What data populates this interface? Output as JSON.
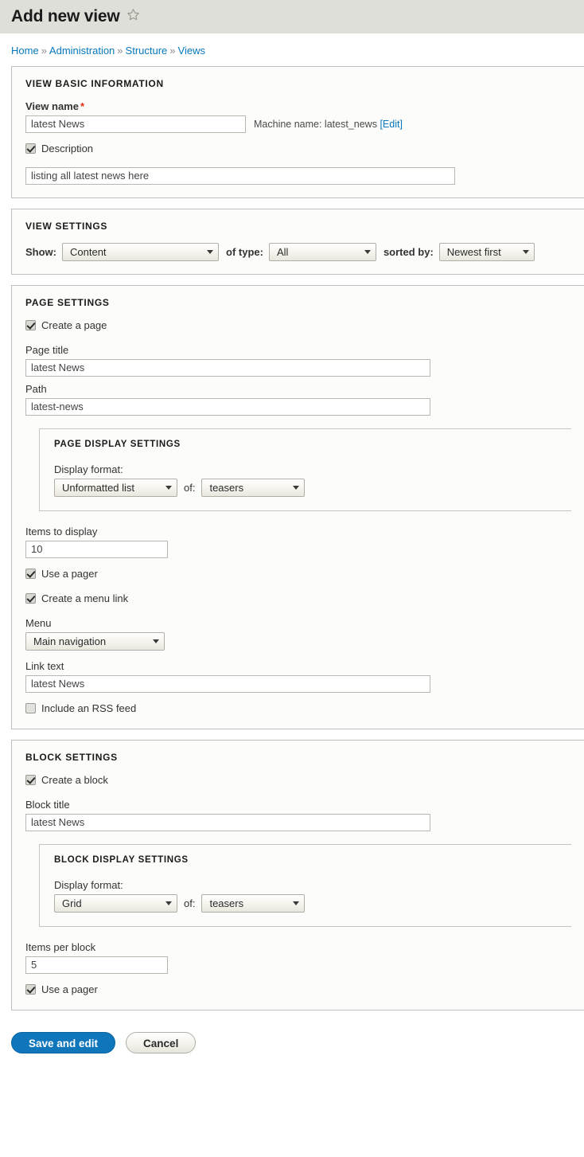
{
  "header": {
    "title": "Add new view",
    "star_icon": "star-outline-icon"
  },
  "breadcrumb": {
    "separator": "»",
    "items": [
      {
        "label": "Home"
      },
      {
        "label": "Administration"
      },
      {
        "label": "Structure"
      },
      {
        "label": "Views"
      }
    ]
  },
  "view_basic_information": {
    "legend": "VIEW BASIC INFORMATION",
    "view_name_label": "View name",
    "required_marker": "*",
    "view_name_value": "latest News",
    "machine_name_prefix": "Machine name: latest_news",
    "machine_name_edit": "[Edit]",
    "description_checkbox_label": "Description",
    "description_checked": true,
    "description_value": "listing all latest news here"
  },
  "view_settings": {
    "legend": "VIEW SETTINGS",
    "show_label": "Show:",
    "show_value": "Content",
    "of_type_label": "of type:",
    "of_type_value": "All",
    "sorted_by_label": "sorted by:",
    "sorted_by_value": "Newest first"
  },
  "page_settings": {
    "legend": "PAGE SETTINGS",
    "create_page_label": "Create a page",
    "create_page_checked": true,
    "page_title_label": "Page title",
    "page_title_value": "latest News",
    "path_label": "Path",
    "path_value": "latest-news",
    "display_settings": {
      "legend": "PAGE DISPLAY SETTINGS",
      "display_format_label": "Display format:",
      "format_value": "Unformatted list",
      "of_label": "of:",
      "of_value": "teasers"
    },
    "items_to_display_label": "Items to display",
    "items_to_display_value": "10",
    "use_pager_label": "Use a pager",
    "use_pager_checked": true,
    "create_menu_link_label": "Create a menu link",
    "create_menu_link_checked": true,
    "menu_label": "Menu",
    "menu_value": "Main navigation",
    "link_text_label": "Link text",
    "link_text_value": "latest News",
    "rss_feed_label": "Include an RSS feed",
    "rss_feed_checked": false
  },
  "block_settings": {
    "legend": "BLOCK SETTINGS",
    "create_block_label": "Create a block",
    "create_block_checked": true,
    "block_title_label": "Block title",
    "block_title_value": "latest News",
    "display_settings": {
      "legend": "BLOCK DISPLAY SETTINGS",
      "display_format_label": "Display format:",
      "format_value": "Grid",
      "of_label": "of:",
      "of_value": "teasers"
    },
    "items_per_block_label": "Items per block",
    "items_per_block_value": "5",
    "use_pager_label": "Use a pager",
    "use_pager_checked": true
  },
  "actions": {
    "save_label": "Save and edit",
    "cancel_label": "Cancel"
  },
  "colors": {
    "header_band": "#dfdfd9",
    "link_blue": "#0678be",
    "primary_button": "#0f76bc",
    "required_red": "#e02a12",
    "panel_background": "#fcfcfa"
  }
}
